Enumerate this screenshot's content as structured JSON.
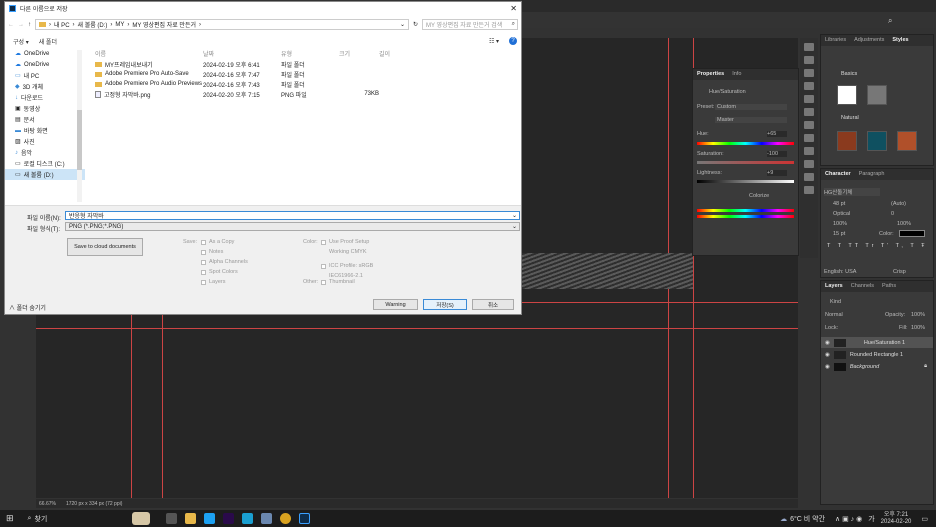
{
  "dialog": {
    "title": "다른 이름으로 저장",
    "path": [
      "내 PC",
      "새 볼륨 (D:)",
      "MY",
      "MY 영상편집 자료 만든거"
    ],
    "search_placeholder": "MY 영상편집 자료 만든거 검색",
    "organize": "구성 ▾",
    "new_folder": "새 폴더",
    "nav": [
      "OneDrive",
      "OneDrive",
      "내 PC",
      "3D 개체",
      "다운로드",
      "동영상",
      "문서",
      "바탕 화면",
      "사진",
      "음악",
      "로컬 디스크 (C:)",
      "새 볼륨 (D:)"
    ],
    "columns": [
      "이름",
      "날짜",
      "유형",
      "크기",
      "길이"
    ],
    "files": [
      {
        "name": "MY프레임내보내기",
        "date": "2024-02-19 오후 6:41",
        "type": "파일 폴더",
        "size": "",
        "folder": true
      },
      {
        "name": "Adobe Premiere Pro Auto-Save",
        "date": "2024-02-16 오후 7:47",
        "type": "파일 폴더",
        "size": "",
        "folder": true
      },
      {
        "name": "Adobe Premiere Pro Audio Previews",
        "date": "2024-02-16 오후 7:43",
        "type": "파일 폴더",
        "size": "",
        "folder": true
      },
      {
        "name": "고정형 자막바.png",
        "date": "2024-02-20 오후 7:15",
        "type": "PNG 파일",
        "size": "73KB",
        "folder": false
      }
    ],
    "filename_label": "파일 이름(N):",
    "filename_value": "반응형 자막바",
    "filetype_label": "파일 형식(T):",
    "filetype_value": "PNG (*.PNG;*.PNG)",
    "cloud_button": "Save to cloud documents",
    "save_label": "Save:",
    "save_options": [
      "As a Copy",
      "Notes",
      "Alpha Channels",
      "Spot Colors",
      "Layers"
    ],
    "color_label": "Color:",
    "color_options": [
      "Use Proof Setup",
      "Working CMYK"
    ],
    "icc_label": "ICC Profile: sRGB",
    "icc_value": "IEC61966-2.1",
    "other_label": "Other:",
    "other_option": "Thumbnail",
    "hide_folders": "폴더 숨기기",
    "warning_button": "Warning",
    "save_button": "저장(S)",
    "cancel_button": "취소"
  },
  "properties": {
    "tabs": [
      "Properties",
      "Info"
    ],
    "title": "Hue/Saturation",
    "preset_label": "Preset:",
    "preset_value": "Custom",
    "channel_value": "Master",
    "hue_label": "Hue:",
    "hue_value": "+65",
    "saturation_label": "Saturation:",
    "saturation_value": "-100",
    "lightness_label": "Lightness:",
    "lightness_value": "+9",
    "colorize_label": "Colorize"
  },
  "styles_panel": {
    "tabs": [
      "Libraries",
      "Adjustments",
      "Styles"
    ],
    "groups": [
      "Basics",
      "Natural"
    ]
  },
  "character": {
    "tabs": [
      "Character",
      "Paragraph"
    ],
    "font": "HG산돌기체",
    "size": "48 pt",
    "leading": "(Auto)",
    "kerning": "Optical",
    "tracking": "0",
    "scale_v": "100%",
    "scale_h": "100%",
    "baseline": "15 pt",
    "color_label": "Color:",
    "language": "English: USA",
    "aa": "Crisp"
  },
  "layers": {
    "tabs": [
      "Layers",
      "Channels",
      "Paths"
    ],
    "kind": "Kind",
    "blend": "Normal",
    "opacity_label": "Opacity:",
    "opacity": "100%",
    "lock_label": "Lock:",
    "fill_label": "Fill:",
    "fill": "100%",
    "items": [
      "Hue/Saturation 1",
      "Rounded Rectangle 1",
      "Background"
    ]
  },
  "status": {
    "zoom": "66.67%",
    "doc": "1720 px x 334 px (72 ppi)"
  },
  "taskbar": {
    "search": "찾기",
    "weather": "6°C 비 약간",
    "time": "오후 7:21",
    "date": "2024-02-20",
    "lang": "가"
  }
}
